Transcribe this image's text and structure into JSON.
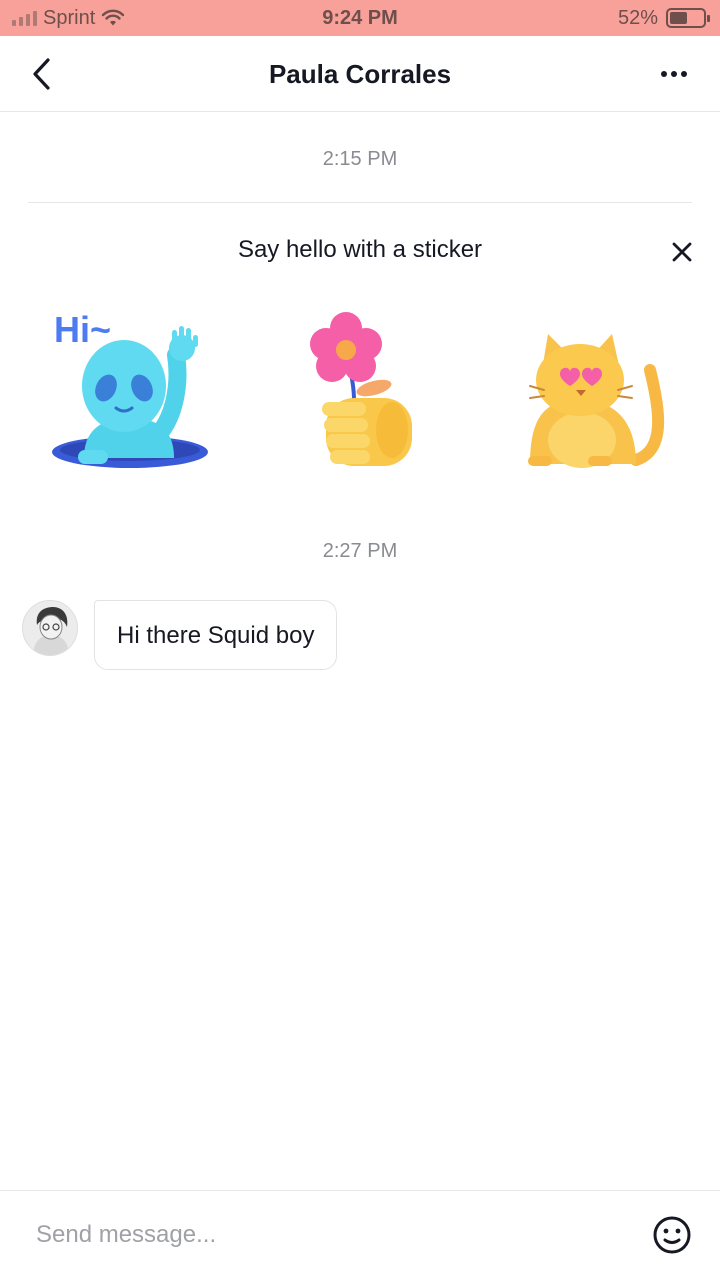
{
  "status_bar": {
    "carrier": "Sprint",
    "time": "9:24 PM",
    "battery_percent": "52%",
    "battery_level": 0.52,
    "signal_icon": "signal-bars-icon",
    "wifi_icon": "wifi-icon",
    "background_color": "#f7a19a"
  },
  "header": {
    "title": "Paula Corrales",
    "back_icon": "chevron-left-icon",
    "more_icon": "more-horizontal-icon"
  },
  "conversation": {
    "timestamp_1": "2:15 PM",
    "sticker_prompt": {
      "text": "Say hello with a sticker",
      "close_icon": "close-icon",
      "stickers": [
        {
          "name": "alien-waving-hi-sticker",
          "text": "Hi~"
        },
        {
          "name": "hand-holding-flower-sticker"
        },
        {
          "name": "heart-eyes-cat-sticker"
        }
      ]
    },
    "timestamp_2": "2:27 PM",
    "messages": [
      {
        "sender": "Paula Corrales",
        "text": "Hi there Squid boy",
        "avatar": "avatar"
      }
    ]
  },
  "composer": {
    "placeholder": "Send message...",
    "emoji_icon": "emoji-smile-icon"
  }
}
